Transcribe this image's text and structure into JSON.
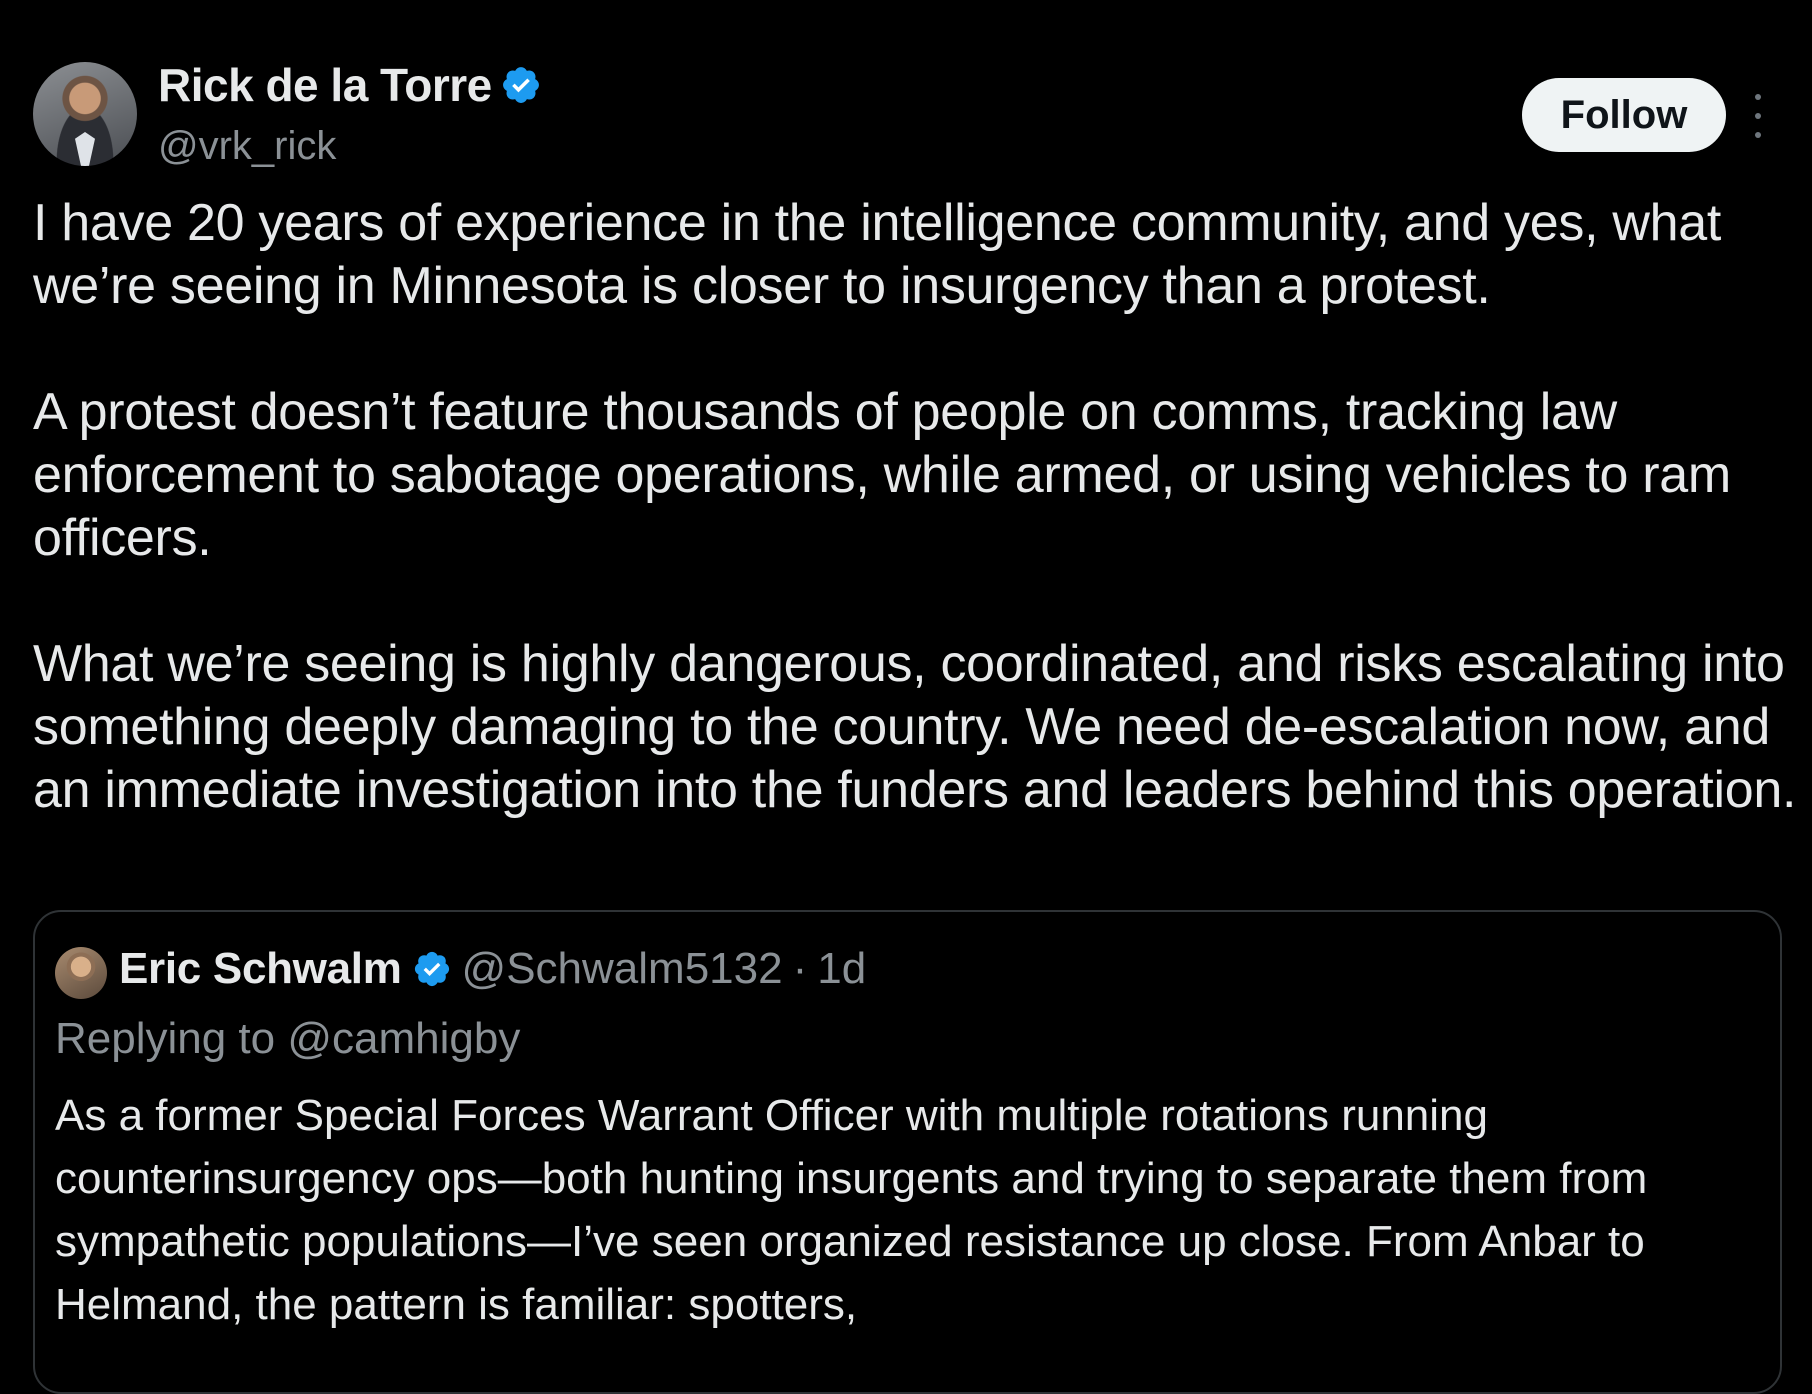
{
  "author": {
    "display_name": "Rick de la Torre",
    "handle": "@vrk_rick",
    "verified": true
  },
  "actions": {
    "follow_label": "Follow",
    "more_icon": "more-vertical-icon"
  },
  "tweet": {
    "paragraphs": [
      "I have 20 years of experience in the intelligence community, and yes, what we’re seeing in Minnesota is closer to insurgency than a protest.",
      "A protest doesn’t feature thousands of people on comms, tracking law enforcement to sabotage operations, while armed, or using vehicles to ram officers.",
      "What we’re seeing is highly dangerous, coordinated, and risks escalating into something deeply damaging to the country. We need de-escalation now, and an immediate investigation into the funders and leaders behind this operation."
    ]
  },
  "quoted_tweet": {
    "display_name": "Eric Schwalm",
    "handle": "@Schwalm5132",
    "separator": "·",
    "time": "1d",
    "verified": true,
    "replying_prefix": "Replying to",
    "replying_to": "@camhigby",
    "text": "As a former Special Forces Warrant Officer with multiple rotations running counterinsurgency ops—both hunting insurgents and trying to separate them from sympathetic populations—I’ve seen organized resistance up close. From Anbar to Helmand, the pattern is familiar: spotters,"
  },
  "colors": {
    "background": "#000000",
    "text_primary": "#e7e9ea",
    "text_secondary": "#8b9196",
    "verified_blue": "#1d9bf0",
    "border": "#2f3336",
    "follow_bg": "#eff3f4"
  }
}
